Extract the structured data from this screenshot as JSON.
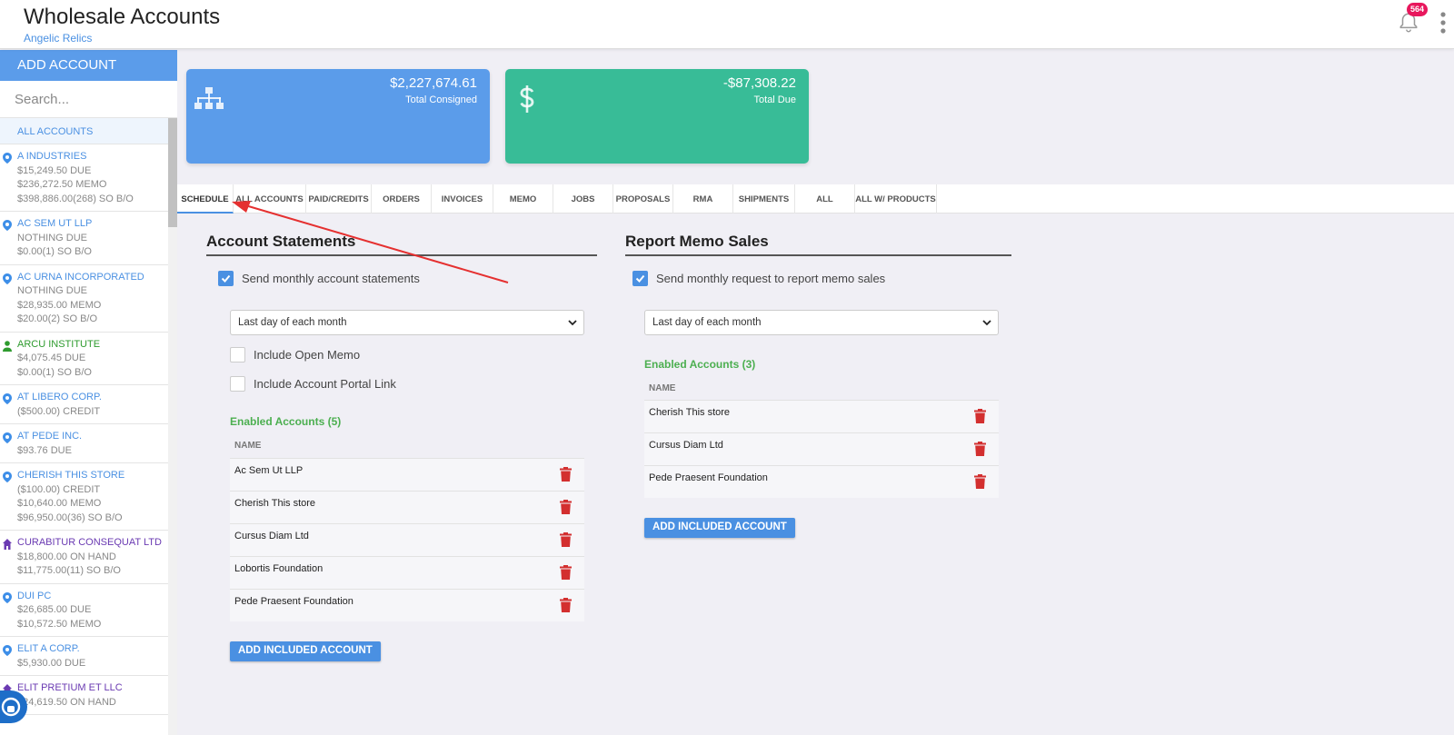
{
  "header": {
    "title": "Wholesale Accounts",
    "subtitle": "Angelic Relics",
    "notification_count": "564"
  },
  "sidebar": {
    "add_label": "ADD ACCOUNT",
    "search_placeholder": "Search...",
    "all_label": "ALL ACCOUNTS",
    "accounts": [
      {
        "name": "A INDUSTRIES",
        "icon": "location-pin-icon",
        "name_color": "blue",
        "lines": [
          {
            "text": "$15,249.50 DUE",
            "color": "red"
          },
          {
            "text": "$236,272.50 MEMO",
            "color": "gray"
          },
          {
            "text": "$398,886.00(268) SO B/O",
            "color": "gray"
          }
        ]
      },
      {
        "name": "AC SEM UT LLP",
        "icon": "location-pin-icon",
        "name_color": "blue",
        "lines": [
          {
            "text": "NOTHING DUE",
            "color": "green"
          },
          {
            "text": "$0.00(1) SO B/O",
            "color": "gray"
          }
        ]
      },
      {
        "name": "AC URNA INCORPORATED",
        "icon": "location-pin-icon",
        "name_color": "blue",
        "lines": [
          {
            "text": "NOTHING DUE",
            "color": "green"
          },
          {
            "text": "$28,935.00 MEMO",
            "color": "gray"
          },
          {
            "text": "$20.00(2) SO B/O",
            "color": "gray"
          }
        ]
      },
      {
        "name": "ARCU INSTITUTE",
        "icon": "person-icon",
        "name_color": "darkgreen",
        "lines": [
          {
            "text": "$4,075.45 DUE",
            "color": "red"
          },
          {
            "text": "$0.00(1) SO B/O",
            "color": "gray"
          }
        ]
      },
      {
        "name": "AT LIBERO CORP.",
        "icon": "location-pin-icon",
        "name_color": "blue",
        "lines": [
          {
            "text": "($500.00) CREDIT",
            "color": "green"
          }
        ]
      },
      {
        "name": "AT PEDE INC.",
        "icon": "location-pin-icon",
        "name_color": "blue",
        "lines": [
          {
            "text": "$93.76 DUE",
            "color": "red"
          }
        ]
      },
      {
        "name": "CHERISH THIS STORE",
        "icon": "location-pin-icon",
        "name_color": "blue",
        "lines": [
          {
            "text": "($100.00) CREDIT",
            "color": "green"
          },
          {
            "text": "$10,640.00 MEMO",
            "color": "gray"
          },
          {
            "text": "$96,950.00(36) SO B/O",
            "color": "gray"
          }
        ]
      },
      {
        "name": "CURABITUR CONSEQUAT LTD",
        "icon": "house-icon",
        "name_color": "purple",
        "lines": [
          {
            "text": "$18,800.00 ON HAND",
            "color": "gray"
          },
          {
            "text": "$11,775.00(11) SO B/O",
            "color": "gray"
          }
        ]
      },
      {
        "name": "DUI PC",
        "icon": "location-pin-icon",
        "name_color": "blue",
        "lines": [
          {
            "text": "$26,685.00 DUE",
            "color": "red"
          },
          {
            "text": "$10,572.50 MEMO",
            "color": "gray"
          }
        ]
      },
      {
        "name": "ELIT A CORP.",
        "icon": "location-pin-icon",
        "name_color": "blue",
        "lines": [
          {
            "text": "$5,930.00 DUE",
            "color": "red"
          }
        ]
      },
      {
        "name": "ELIT PRETIUM ET LLC",
        "icon": "house-icon",
        "name_color": "purple",
        "lines": [
          {
            "text": "$24,619.50 ON HAND",
            "color": "gray"
          }
        ]
      }
    ]
  },
  "cards": {
    "consigned_amount": "$2,227,674.61",
    "consigned_label": "Total Consigned",
    "due_amount": "-$87,308.22",
    "due_label": "Total Due"
  },
  "tabs": [
    "SCHEDULE",
    "ALL ACCOUNTS",
    "PAID/CREDITS",
    "ORDERS",
    "INVOICES",
    "MEMO",
    "JOBS",
    "PROPOSALS",
    "RMA",
    "SHIPMENTS",
    "ALL",
    "ALL W/ PRODUCTS"
  ],
  "statements": {
    "title": "Account Statements",
    "send_label": "Send monthly account statements",
    "schedule_value": "Last day of each month",
    "open_memo_label": "Include Open Memo",
    "portal_link_label": "Include Account Portal Link",
    "enabled_label": "Enabled Accounts (5)",
    "name_header": "NAME",
    "accounts": [
      "Ac Sem Ut LLP",
      "Cherish This store",
      "Cursus Diam Ltd",
      "Lobortis Foundation",
      "Pede Praesent Foundation"
    ],
    "add_label": "ADD INCLUDED ACCOUNT"
  },
  "memo_sales": {
    "title": "Report Memo Sales",
    "send_label": "Send monthly request to report memo sales",
    "schedule_value": "Last day of each month",
    "enabled_label": "Enabled Accounts (3)",
    "name_header": "NAME",
    "accounts": [
      "Cherish This store",
      "Cursus Diam Ltd",
      "Pede Praesent Foundation"
    ],
    "add_label": "ADD INCLUDED ACCOUNT"
  },
  "colors": {
    "accent_blue": "#5b9cea",
    "accent_green": "#38bc97",
    "due_red": "#d0312d",
    "nothing_due_green": "#4caf50",
    "trash_red": "#d32f2f",
    "annotation_arrow": "#e53030"
  }
}
